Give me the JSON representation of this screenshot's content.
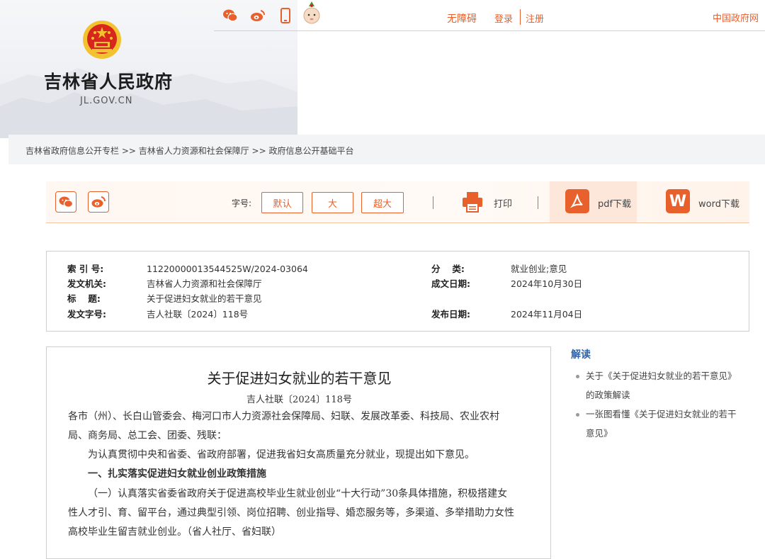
{
  "header": {
    "site_title": "吉林省人民政府",
    "site_domain": "JL.GOV.CN",
    "icons": [
      "wechat-icon",
      "weibo-icon",
      "mobile-icon",
      "mascot-icon"
    ],
    "accessibility": "无障碍",
    "login": "登录",
    "register": "注册",
    "gov_link": "中国政府网"
  },
  "breadcrumb": "吉林省政府信息公开专栏 >> 吉林省人力资源和社会保障厅 >> 政府信息公开基础平台",
  "toolbar": {
    "font_label": "字号:",
    "font_default": "默认",
    "font_large": "大",
    "font_xlarge": "超大",
    "print": "打印",
    "pdf_download": "pdf下载",
    "pdf_icon_text": "",
    "word_download": "word下载",
    "word_icon_text": "W"
  },
  "meta": {
    "index_label": "索 引 号:",
    "index_value": "11220000013544525W/2024-03064",
    "category_label": "分　 类:",
    "category_value": "就业创业;意见",
    "issuer_label": "发文机关:",
    "issuer_value": "吉林省人力资源和社会保障厅",
    "created_label": "成文日期:",
    "created_value": "2024年10月30日",
    "title_label": "标　 题:",
    "title_value": "关于促进妇女就业的若干意见",
    "docno_label": "发文字号:",
    "docno_value": "吉人社联〔2024〕118号",
    "published_label": "发布日期:",
    "published_value": "2024年11月04日"
  },
  "document": {
    "title": "关于促进妇女就业的若干意见",
    "doc_number": "吉人社联〔2024〕118号",
    "addressee_line1": "各市（州）、长白山管委会、梅河口市人力资源社会保障局、妇联、发展改革委、科技局、农业农村",
    "addressee_line2": "局、商务局、总工会、团委、残联：",
    "intro": "为认真贯彻中央和省委、省政府部署，促进我省妇女高质量充分就业，现提出如下意见。",
    "section1_heading": "一、扎实落实促进妇女就业创业政策措施",
    "item1_line1": "（一）认真落实省委省政府关于促进高校毕业生就业创业“十大行动”30条具体措施，积极搭建女",
    "item1_line2": "性人才引、育、留平台，通过典型引领、岗位招聘、创业指导、婚恋服务等，多渠道、多举措助力女性",
    "item1_line3": "高校毕业生留吉就业创业。（省人社厅、省妇联）"
  },
  "sidebar": {
    "title": "解读",
    "item1_line1": "关于《关于促进妇女就业的若干意见》",
    "item1_line2": "的政策解读",
    "item2_line1": "一张图看懂《关于促进妇女就业的若干",
    "item2_line2": "意见》"
  },
  "colors": {
    "accent": "#e8602c",
    "link_blue": "#2e64a8",
    "emblem_red": "#d7261c",
    "emblem_gold": "#f2c230"
  }
}
